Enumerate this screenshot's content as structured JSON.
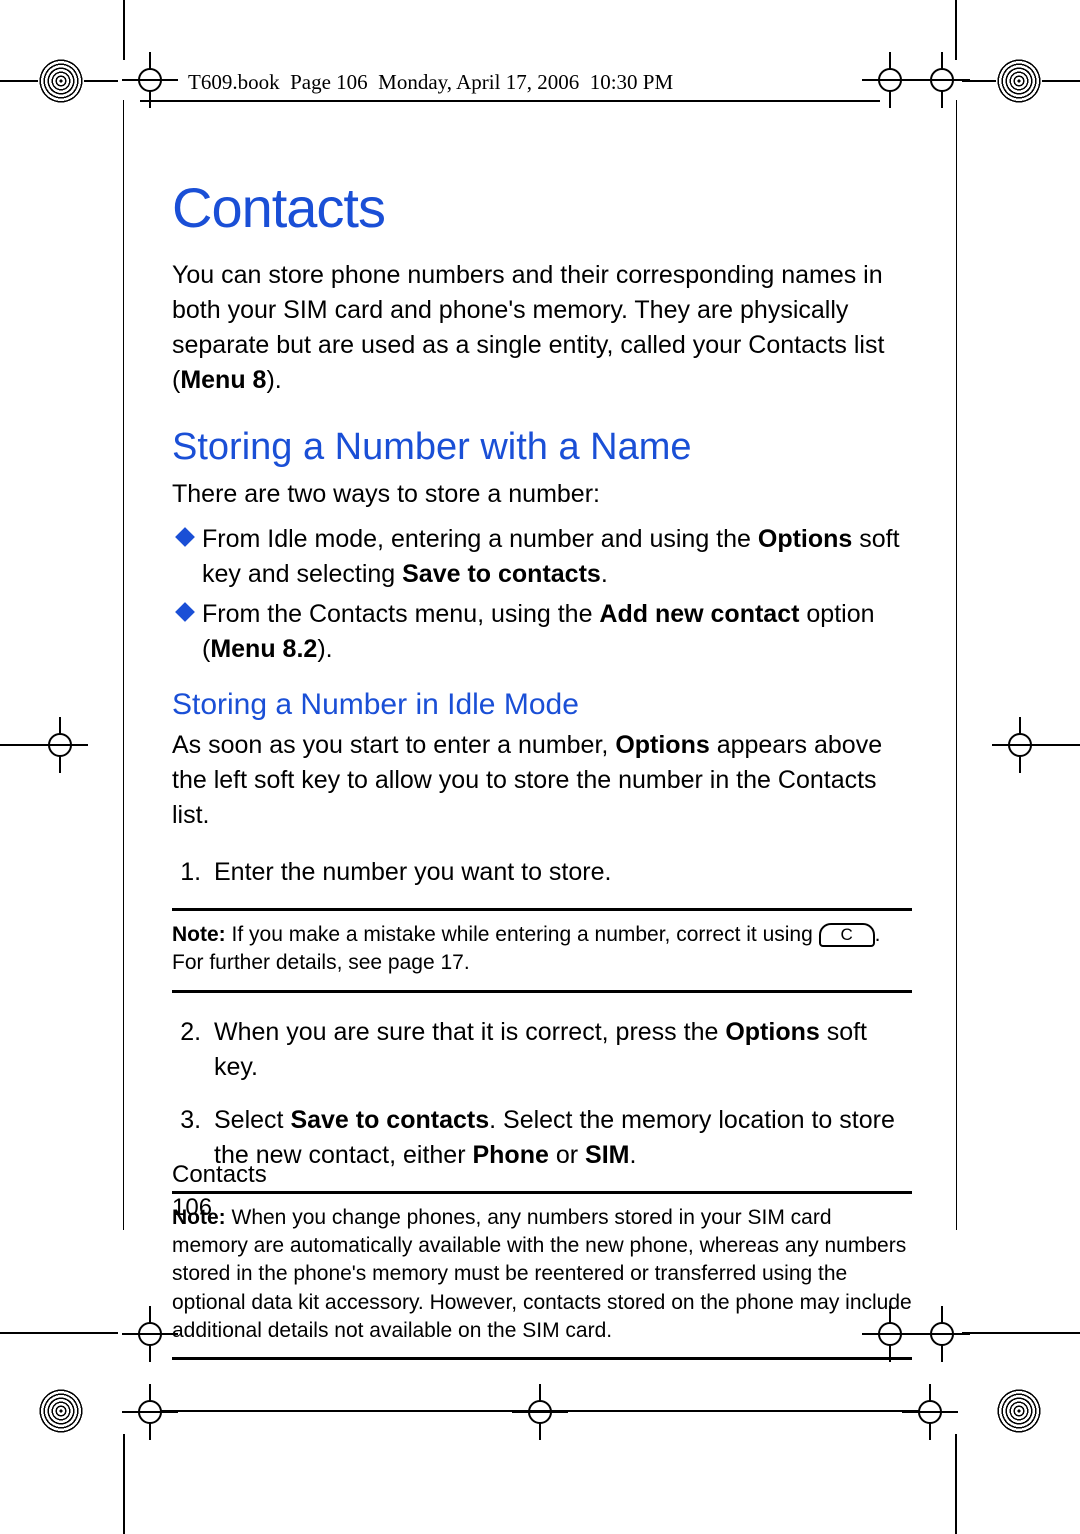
{
  "header": {
    "running_head": "T609.book  Page 106  Monday, April 17, 2006  10:30 PM"
  },
  "chapter_title": "Contacts",
  "intro": {
    "text_before_bold": "You can store phone numbers and their corresponding names in both your SIM card and phone's memory. They are physically separate but are used as a single entity, called your Contacts list (",
    "menu_ref": "Menu 8",
    "text_after_bold": ")."
  },
  "section1": {
    "title": "Storing a Number with a Name",
    "intro": "There are two ways to store a number:",
    "bullets": [
      {
        "b0": "From Idle mode, entering a number and using the ",
        "b0_bold1": "Options",
        "b0_mid": " soft key and selecting ",
        "b0_bold2": "Save to contacts",
        "b0_end": "."
      },
      {
        "b1": "From the Contacts menu, using the ",
        "b1_bold1": "Add new contact",
        "b1_mid": " option (",
        "b1_bold2": "Menu 8.2",
        "b1_end": ")."
      }
    ]
  },
  "subsection": {
    "title": "Storing a Number in Idle Mode",
    "intro_before_bold": "As soon as you start to enter a number, ",
    "intro_bold": "Options",
    "intro_after_bold": " appears above the left soft key to allow you to store the number in the Contacts list.",
    "steps": [
      {
        "text": "Enter the number you want to store."
      },
      {
        "pre": "When you are sure that it is correct, press the ",
        "bold": "Options",
        "post": " soft key."
      },
      {
        "pre": "Select ",
        "bold1": "Save to contacts",
        "mid": ". Select the memory location to store the new contact, either ",
        "bold2": "Phone",
        "or": " or ",
        "bold3": "SIM",
        "post": "."
      }
    ]
  },
  "note1": {
    "label": "Note:",
    "pre": " If you make a mistake while entering a number, correct it using ",
    "key": "C",
    "post": ". For further details, see page 17."
  },
  "note2": {
    "label": "Note:",
    "text": " When you change phones, any numbers stored in your SIM card memory are automatically available with the new phone, whereas any numbers stored in the phone's memory must be reentered or transferred using the optional data kit accessory. However, contacts stored on the phone may include additional details not available on the SIM card."
  },
  "footer": {
    "section": "Contacts",
    "page": "106"
  }
}
